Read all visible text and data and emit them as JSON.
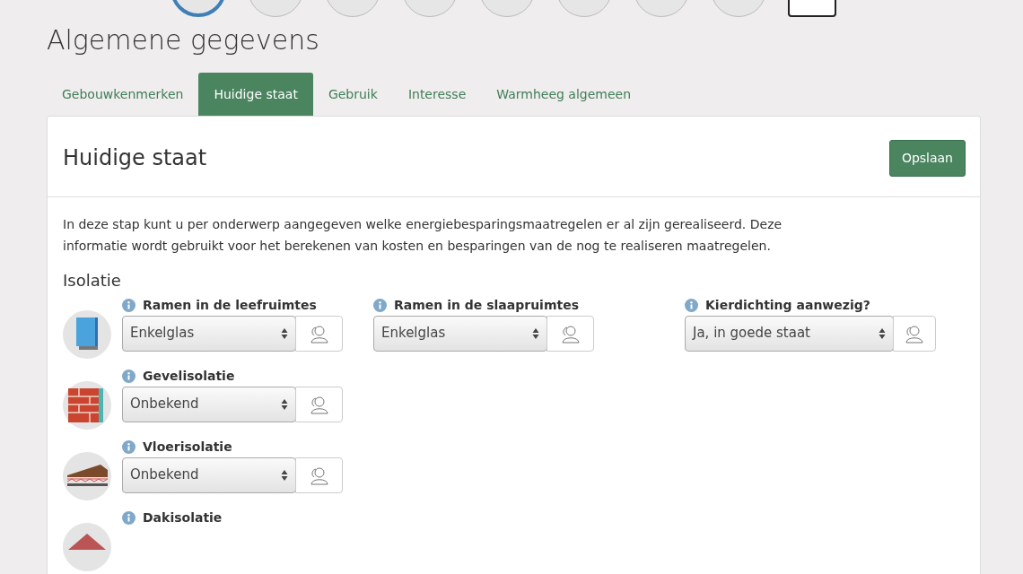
{
  "steps": [
    {
      "kind": "circle",
      "selected": true
    },
    {
      "kind": "circle",
      "selected": false
    },
    {
      "kind": "circle",
      "selected": false
    },
    {
      "kind": "circle",
      "selected": false
    },
    {
      "kind": "circle",
      "selected": false
    },
    {
      "kind": "circle",
      "selected": false
    },
    {
      "kind": "circle",
      "selected": false
    },
    {
      "kind": "circle",
      "selected": false
    },
    {
      "kind": "card",
      "selected": false
    }
  ],
  "page_title": "Algemene gegevens",
  "tabs": [
    {
      "label": "Gebouwkenmerken",
      "selected": false
    },
    {
      "label": "Huidige staat",
      "selected": true
    },
    {
      "label": "Gebruik",
      "selected": false
    },
    {
      "label": "Interesse",
      "selected": false
    },
    {
      "label": "Warmheeg algemeen",
      "selected": false
    }
  ],
  "panel": {
    "title": "Huidige staat",
    "save_button": "Opslaan",
    "intro": "In deze stap kunt u per onderwerp aangegeven welke energiebesparingsmaatregelen er al zijn gerealiseerd. Deze informatie wordt gebruikt voor het berekenen van kosten en besparingen van de nog te realiseren maatregelen.",
    "section": "Isolatie",
    "rows": [
      {
        "kind": "window",
        "fields": [
          {
            "label": "Ramen in de leefruimtes",
            "value": "Enkelglas"
          },
          {
            "label": "Ramen in de slaapruimtes",
            "value": "Enkelglas"
          },
          {
            "label": "Kierdichting aanwezig?",
            "value": "Ja, in goede staat"
          }
        ]
      },
      {
        "kind": "wall",
        "fields": [
          {
            "label": "Gevelisolatie",
            "value": "Onbekend"
          }
        ]
      },
      {
        "kind": "floor",
        "fields": [
          {
            "label": "Vloerisolatie",
            "value": "Onbekend"
          }
        ]
      },
      {
        "kind": "roof",
        "fields": [
          {
            "label": "Dakisolatie"
          }
        ]
      }
    ]
  }
}
